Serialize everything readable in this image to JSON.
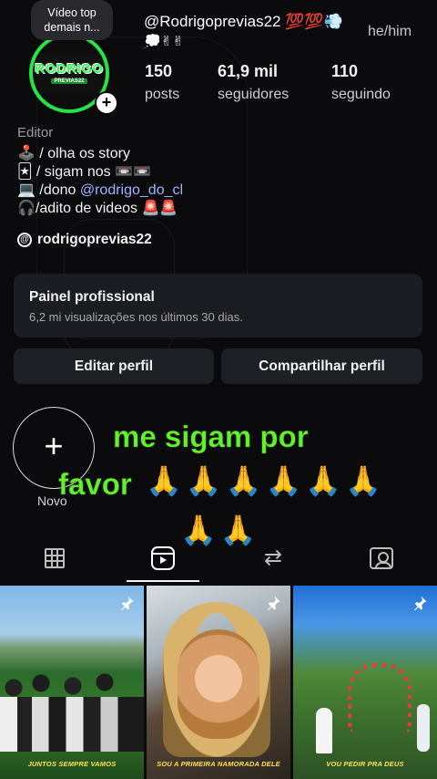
{
  "tooltip": {
    "text": "Vídeo top demais n..."
  },
  "profile": {
    "avatar_logo_main": "RODRIGO",
    "avatar_logo_sub": "PREVIAS22",
    "handle": "@Rodrigoprevias22 💯💯💨",
    "handle_emojis": "💭✌✌",
    "pronouns": "he/him"
  },
  "stats": [
    {
      "value": "150",
      "label": "posts"
    },
    {
      "value": "61,9 mil",
      "label": "seguidores"
    },
    {
      "value": "110",
      "label": "seguindo"
    }
  ],
  "bio": {
    "category": "Editor",
    "line1": "🕹️ / olha os story",
    "line2_prefix": "🃏 / sigam nos ",
    "line2_emojis": "📼📼",
    "line3_prefix": "💻 /dono ",
    "line3_mention": "@rodrigo_do_cl",
    "line4": "🎧/adito de videos 🚨🚨"
  },
  "threads": {
    "label": "rodrigoprevias22",
    "icon": "threads-icon"
  },
  "panel": {
    "title": "Painel profissional",
    "subtitle": "6,2 mi visualizações nos últimos 30 dias."
  },
  "buttons": {
    "edit": "Editar perfil",
    "share": "Compartilhar perfil"
  },
  "highlight": {
    "new_label": "Novo",
    "plus": "+"
  },
  "overlay": {
    "line1": "me sigam por",
    "line2": "favor",
    "prayers1": "🙏🙏🙏🙏🙏🙏",
    "prayers2": "🙏🙏"
  },
  "tabs": [
    {
      "icon": "grid-icon",
      "active": false
    },
    {
      "icon": "reels-icon",
      "active": true
    },
    {
      "icon": "repost-icon",
      "active": false
    },
    {
      "icon": "tagged-icon",
      "active": false
    }
  ],
  "thumbnails": [
    {
      "caption": "JUNTOS SEMPRE VAMOS",
      "pinned": true
    },
    {
      "caption": "SOU A PRIMEIRA NAMORADA DELE",
      "pinned": true
    },
    {
      "caption": "VOU PEDIR PRA DEUS",
      "pinned": true
    }
  ],
  "colors": {
    "background": "#0b0b0d",
    "avatar_ring": "#27e34a",
    "overlay_text": "#64f02d",
    "mention": "#9fb2ff",
    "caption": "#ffe34d"
  }
}
